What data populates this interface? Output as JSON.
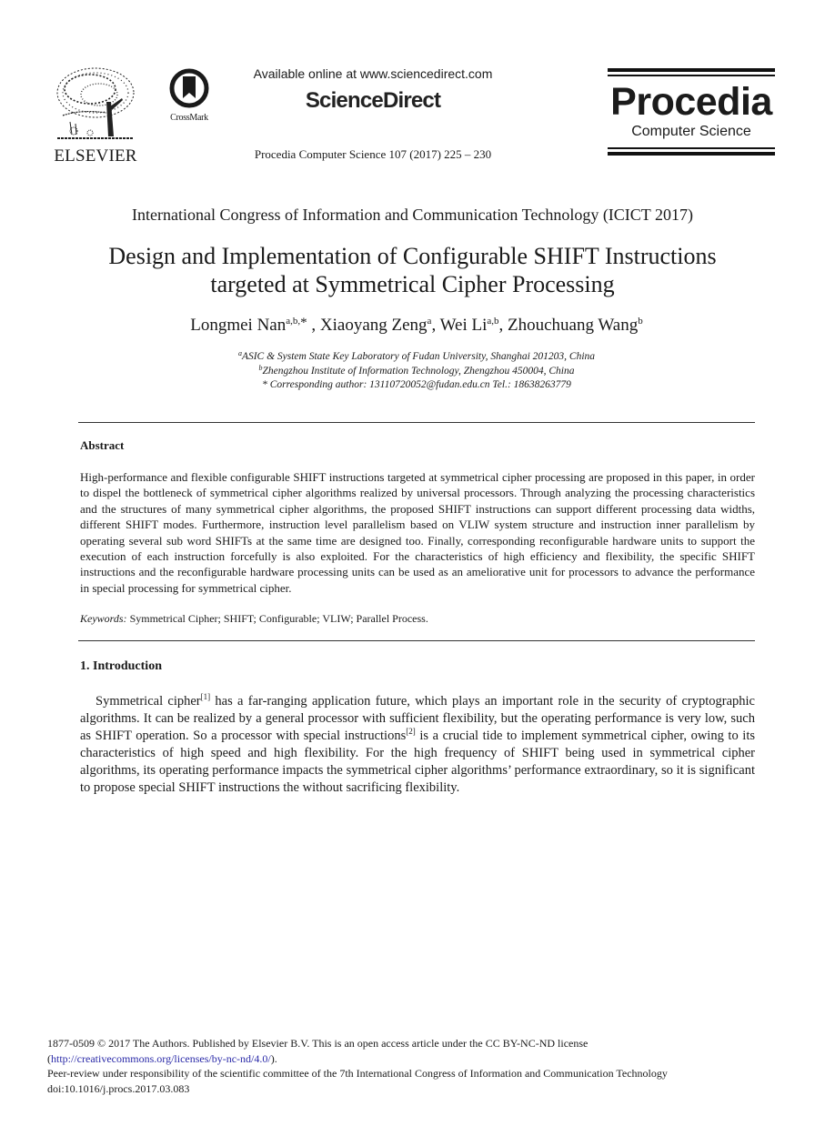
{
  "header": {
    "publisher_logo_text": "ELSEVIER",
    "crossmark_label": "CrossMark",
    "available_online": "Available online at www.sciencedirect.com",
    "platform_brand": "ScienceDirect",
    "journal_citation": "Procedia Computer Science 107 (2017) 225 – 230",
    "journal_logo_title": "Procedia",
    "journal_logo_subtitle": "Computer Science"
  },
  "paper": {
    "conference": "International Congress of Information and Communication Technology (ICICT 2017)",
    "title_line1": "Design and Implementation of Configurable SHIFT Instructions",
    "title_line2": "targeted at Symmetrical Cipher Processing",
    "authors": [
      {
        "name": "Longmei Nan",
        "sup": "a,b,",
        "mark": "*",
        "sep": " , "
      },
      {
        "name": "Xiaoyang Zeng",
        "sup": "a",
        "sep": ", "
      },
      {
        "name": "Wei Li",
        "sup": "a,b",
        "sep": ", "
      },
      {
        "name": "Zhouchuang Wang",
        "sup": "b",
        "sep": ""
      }
    ],
    "affiliations": [
      {
        "sup": "a",
        "text": "ASIC & System State Key Laboratory of Fudan University, Shanghai 201203, China"
      },
      {
        "sup": "b",
        "text": "Zhengzhou Institute of Information Technology, Zhengzhou 450004, China"
      }
    ],
    "corresponding": "* Corresponding author: 13110720052@fudan.edu.cn Tel.: 18638263779"
  },
  "abstract": {
    "heading": "Abstract",
    "text": "High-performance and flexible configurable SHIFT instructions targeted at symmetrical cipher processing are proposed in this paper, in order to dispel the bottleneck of symmetrical cipher algorithms realized by universal processors. Through analyzing the processing characteristics and the structures of many symmetrical cipher algorithms, the proposed SHIFT instructions can support different processing data widths, different SHIFT modes. Furthermore, instruction level parallelism based on VLIW system structure and instruction inner parallelism by operating several sub word SHIFTs at the same time are designed too. Finally, corresponding reconfigurable hardware units to support the execution of each instruction forcefully is also exploited. For the characteristics of high efficiency and flexibility, the specific SHIFT instructions and the reconfigurable hardware processing units can be used as an ameliorative unit for processors to advance the performance in special processing for symmetrical cipher.",
    "keywords_label": "Keywords:",
    "keywords": "Symmetrical Cipher; SHIFT; Configurable; VLIW; Parallel Process."
  },
  "introduction": {
    "heading": "1. Introduction",
    "seg1": "Symmetrical cipher",
    "ref1": "[1]",
    "seg2": " has a far-ranging application future, which plays an important role in the security of cryptographic algorithms. It can be realized by a general processor with sufficient flexibility, but the operating performance is very low, such as SHIFT operation. So a processor with special instructions",
    "ref2": "[2]",
    "seg3": " is a crucial tide to implement symmetrical cipher, owing to its characteristics of high speed and high flexibility. For the high frequency of SHIFT being used in symmetrical cipher algorithms, its operating performance impacts the symmetrical cipher algorithms’ performance extraordinary, so it is significant to propose special SHIFT instructions the without sacrificing flexibility."
  },
  "footer": {
    "line1": "1877-0509 © 2017 The Authors. Published by Elsevier B.V. This is an open access article under the CC BY-NC-ND license",
    "license_open": "(",
    "license_link": "http://creativecommons.org/licenses/by-nc-nd/4.0/",
    "license_close": ").",
    "line3": "Peer-review under responsibility of the scientific committee of the 7th International Congress of Information and Communication Technology",
    "doi": "doi:10.1016/j.procs.2017.03.083"
  }
}
